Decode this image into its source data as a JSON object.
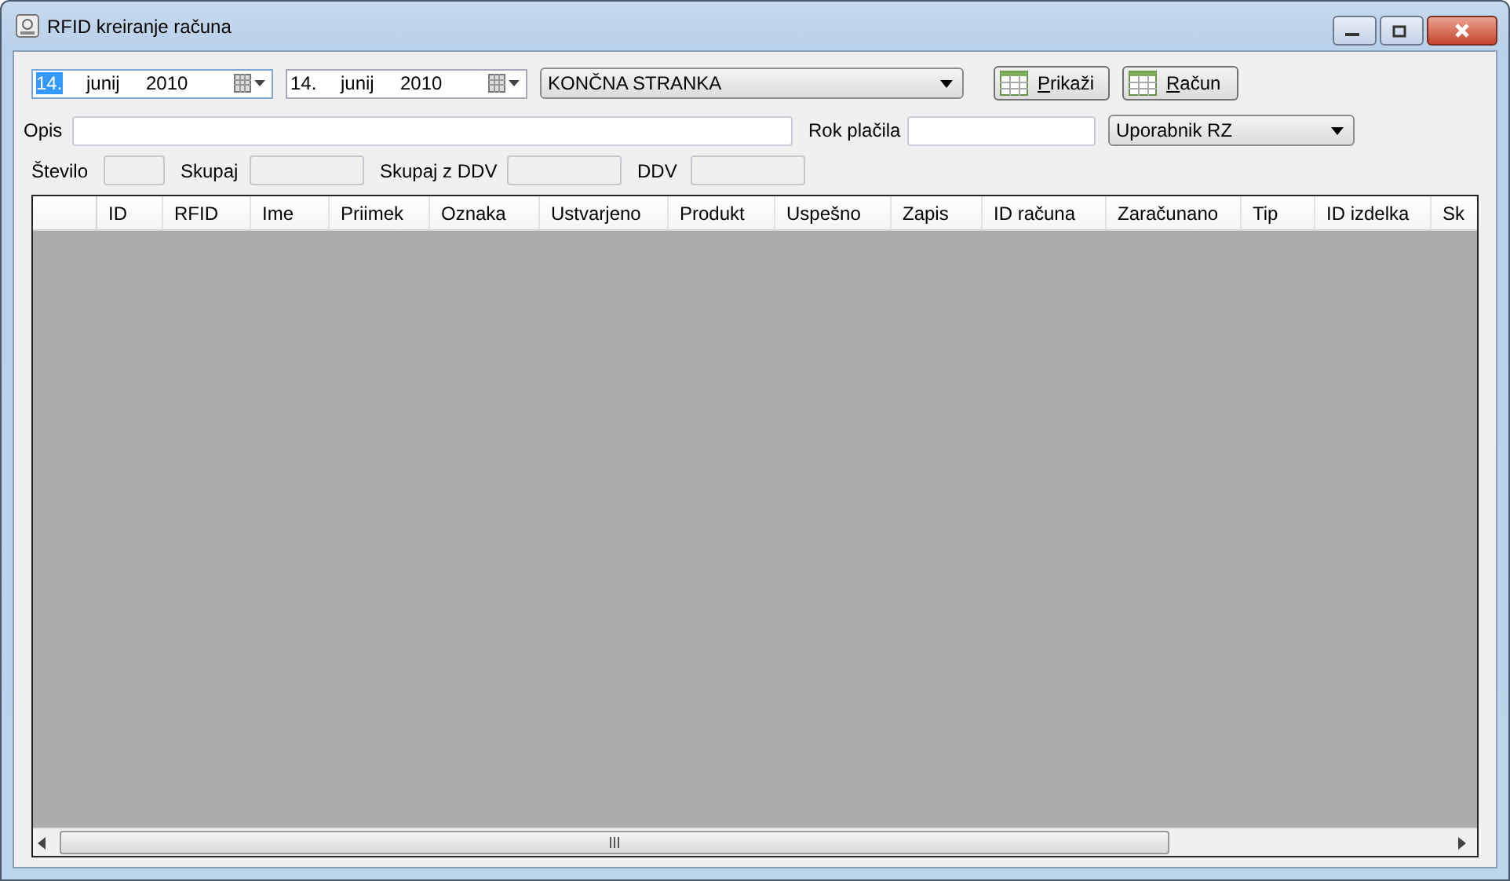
{
  "window": {
    "title": "RFID kreiranje računa",
    "controls": [
      {
        "kind": "minimize"
      },
      {
        "kind": "maximize"
      },
      {
        "kind": "close"
      }
    ]
  },
  "date_from": {
    "day": "14.",
    "month": "junij",
    "year": "2010",
    "day_highlighted": true
  },
  "date_to": {
    "day": "14.",
    "month": "junij",
    "year": "2010",
    "day_highlighted": false
  },
  "customer_dropdown": {
    "value": "KONČNA STRANKA"
  },
  "buttons": [
    {
      "label": "Prikaži"
    },
    {
      "label": "Račun"
    }
  ],
  "description": {
    "label": "Opis"
  },
  "due_date": {
    "label": "Rok plačila"
  },
  "user_dropdown": {
    "value": "Uporabnik RZ"
  },
  "totals": [
    {
      "label": "Število"
    },
    {
      "label": "Skupaj"
    },
    {
      "label": "Skupaj z DDV"
    },
    {
      "label": "DDV"
    }
  ],
  "table": {
    "columns": [
      "ID",
      "RFID",
      "Ime",
      "Priimek",
      "Oznaka",
      "Ustvarjeno",
      "Produkt",
      "Uspešno",
      "Zapis",
      "ID računa",
      "Zaračunano",
      "Tip",
      "ID izdelka",
      "Sk"
    ]
  }
}
